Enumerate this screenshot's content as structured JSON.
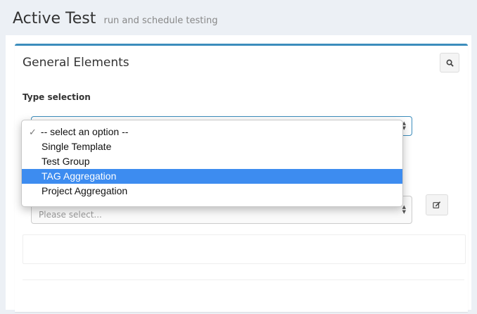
{
  "header": {
    "title": "Active Test",
    "subtitle": "run and schedule testing"
  },
  "box": {
    "title": "General Elements",
    "search_icon": "search-icon",
    "edit_icon": "edit-icon"
  },
  "form": {
    "type_label": "Type selection",
    "second_placeholder": "Please select..."
  },
  "dropdown": {
    "options": [
      "-- select an option --",
      "Single Template",
      "Test Group",
      "TAG Aggregation",
      "Project Aggregation"
    ],
    "checked_index": 0,
    "highlighted_index": 3
  },
  "colors": {
    "accent": "#3c8dbc",
    "highlight": "#3d8cf0",
    "background": "#ecf0f5"
  }
}
